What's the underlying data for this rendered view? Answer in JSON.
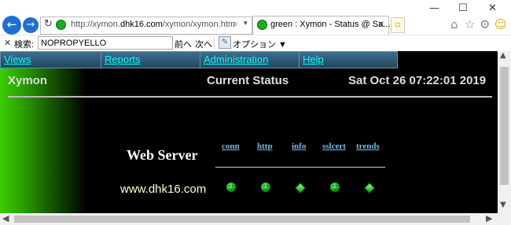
{
  "browser": {
    "window_controls": {
      "minimize": "—",
      "maximize": "☐",
      "close": "✕"
    },
    "address_bar": {
      "url_prefix": "http://xymon.",
      "url_domain": "dhk16.com",
      "url_suffix": "/xymon/xymon.htm"
    },
    "tab": {
      "title": "green : Xymon - Status @ Sa...",
      "close": "×"
    },
    "find_bar": {
      "label": "検索:",
      "query": "NOPROPYELLO",
      "prev_label": "前へ",
      "next_label": "次へ",
      "options_label": "オプション ▼"
    }
  },
  "page": {
    "menu": [
      "Views",
      "Reports",
      "Administration",
      "Help"
    ],
    "brand": "Xymon",
    "heading": "Current Status",
    "datetime": "Sat Oct 26 07:22:01 2019",
    "group_title": "Web Server",
    "columns": [
      "conn",
      "http",
      "info",
      "sslcert",
      "trends"
    ],
    "rows": [
      {
        "host": "www.dhk16.com",
        "statuses": [
          {
            "test": "conn",
            "color": "green",
            "icon": "smiley-icon"
          },
          {
            "test": "http",
            "color": "green",
            "icon": "smiley-icon"
          },
          {
            "test": "info",
            "color": "green",
            "icon": "diamond-icon"
          },
          {
            "test": "sslcert",
            "color": "green",
            "icon": "smiley-icon"
          },
          {
            "test": "trends",
            "color": "green",
            "icon": "diamond-icon"
          }
        ]
      }
    ]
  },
  "colors": {
    "page_bg": "#000000",
    "link": "#00ffff",
    "column_header": "#7cb7dd",
    "hostname": "#ffffcc",
    "status_green": "#1faa1f"
  }
}
